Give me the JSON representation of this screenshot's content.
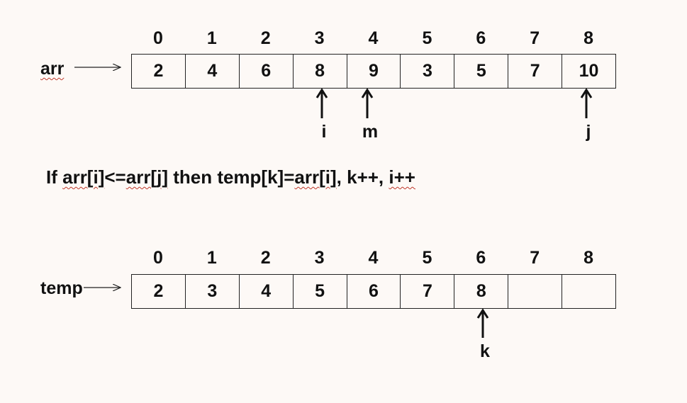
{
  "arr": {
    "label": "arr",
    "indices": [
      "0",
      "1",
      "2",
      "3",
      "4",
      "5",
      "6",
      "7",
      "8"
    ],
    "values": [
      "2",
      "4",
      "6",
      "8",
      "9",
      "3",
      "5",
      "7",
      "10"
    ],
    "pointers": [
      {
        "name": "i",
        "index": 3
      },
      {
        "name": "m",
        "index": 4
      },
      {
        "name": "j",
        "index": 8
      }
    ]
  },
  "condition": {
    "prefix": "If ",
    "arr_i": "arr[i]",
    "le": "<=",
    "arr_j": "arr[j]",
    "mid": " then temp[k]=",
    "arr_i2": "arr[i]",
    "sep": ", k++, ",
    "ipp": "i++"
  },
  "temp": {
    "label": "temp",
    "indices": [
      "0",
      "1",
      "2",
      "3",
      "4",
      "5",
      "6",
      "7",
      "8"
    ],
    "values": [
      "2",
      "3",
      "4",
      "5",
      "6",
      "7",
      "8",
      "",
      ""
    ],
    "pointers": [
      {
        "name": "k",
        "index": 6
      }
    ]
  }
}
